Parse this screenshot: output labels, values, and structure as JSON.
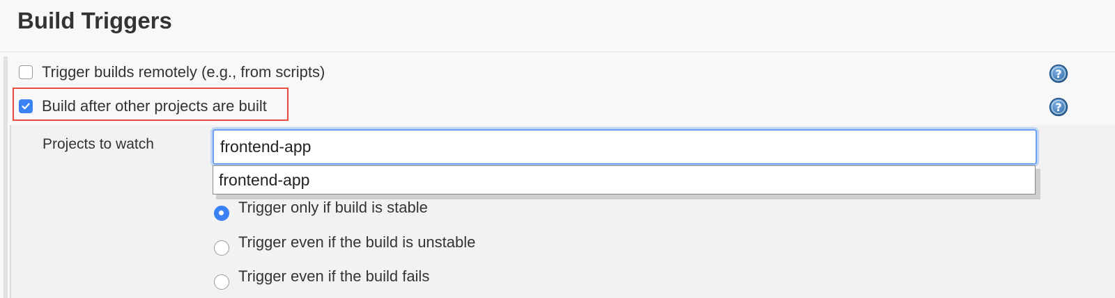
{
  "section": {
    "title": "Build Triggers"
  },
  "triggers": {
    "remote": {
      "label": "Trigger builds remotely (e.g., from scripts)",
      "checked": false,
      "help_icon": "question-mark-icon"
    },
    "after_other": {
      "label": "Build after other projects are built",
      "checked": true,
      "help_icon": "question-mark-icon"
    }
  },
  "projects_field": {
    "label": "Projects to watch",
    "value": "frontend-app",
    "suggestions": [
      "frontend-app"
    ]
  },
  "threshold": {
    "options": [
      {
        "label": "Trigger only if build is stable",
        "selected": true
      },
      {
        "label": "Trigger even if the build is unstable",
        "selected": false
      },
      {
        "label": "Trigger even if the build fails",
        "selected": false
      }
    ]
  },
  "colors": {
    "accent": "#3b82f6",
    "highlight_border": "#e74c3c",
    "help_icon": "#2e6da4"
  }
}
